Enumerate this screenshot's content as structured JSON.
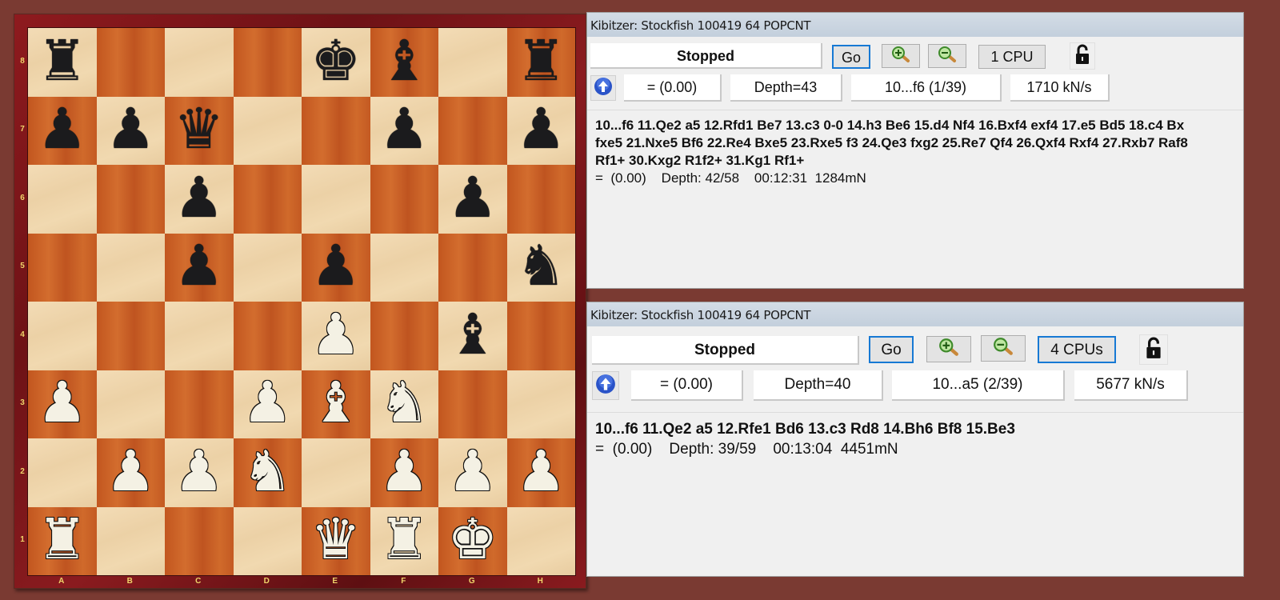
{
  "board": {
    "files": [
      "A",
      "B",
      "C",
      "D",
      "E",
      "F",
      "G",
      "H"
    ],
    "ranks": [
      "8",
      "7",
      "6",
      "5",
      "4",
      "3",
      "2",
      "1"
    ],
    "position": [
      [
        "bR",
        "",
        "",
        "",
        "bK",
        "bB",
        "",
        "bR"
      ],
      [
        "bP",
        "bP",
        "bQ",
        "",
        "",
        "bP",
        "",
        "bP"
      ],
      [
        "",
        "",
        "bP",
        "",
        "",
        "",
        "bP",
        ""
      ],
      [
        "",
        "",
        "bP",
        "",
        "bP",
        "",
        "",
        "bN"
      ],
      [
        "",
        "",
        "",
        "",
        "wP",
        "",
        "bB",
        ""
      ],
      [
        "wP",
        "",
        "",
        "wP",
        "wB",
        "wN",
        "",
        ""
      ],
      [
        "",
        "wP",
        "wP",
        "wN",
        "",
        "wP",
        "wP",
        "wP"
      ],
      [
        "wR",
        "",
        "",
        "",
        "wQ",
        "wR",
        "wK",
        ""
      ]
    ],
    "piece_names": {
      "K": "king",
      "Q": "queen",
      "R": "rook",
      "B": "bishop",
      "N": "knight",
      "P": "pawn"
    },
    "glyphs": {
      "K": "♚",
      "Q": "♛",
      "R": "♜",
      "B": "♝",
      "N": "♞",
      "P": "♟"
    }
  },
  "kibitzers": [
    {
      "title": "Kibitzer: Stockfish 100419 64 POPCNT",
      "status": "Stopped",
      "go_label": "Go",
      "cpu_label": "1 CPU",
      "eval": "=  (0.00)",
      "depth": "Depth=43",
      "current_move": "10...f6 (1/39)",
      "speed": "1710 kN/s",
      "pv_lines": [
        "10...f6 11.Qe2 a5 12.Rfd1 Be7 13.c3 0-0 14.h3 Be6 15.d4 Nf4 16.Bxf4 exf4 17.e5 Bd5 18.c4 Bx",
        "fxe5 21.Nxe5 Bf6 22.Re4 Bxe5 23.Rxe5 f3 24.Qe3 fxg2 25.Re7 Qf4 26.Qxf4 Rxf4 27.Rxb7 Raf8",
        "Rf1+ 30.Kxg2 R1f2+ 31.Kg1 Rf1+"
      ],
      "info": "=  (0.00)    Depth: 42/58    00:12:31  1284mN"
    },
    {
      "title": "Kibitzer: Stockfish 100419 64 POPCNT",
      "status": "Stopped",
      "go_label": "Go",
      "cpu_label": "4 CPUs",
      "eval": "=  (0.00)",
      "depth": "Depth=40",
      "current_move": "10...a5 (2/39)",
      "speed": "5677 kN/s",
      "pv_lines": [
        "10...f6 11.Qe2 a5 12.Rfe1 Bd6 13.c3 Rd8 14.Bh6 Bf8 15.Be3"
      ],
      "info": "=  (0.00)    Depth: 39/59    00:13:04  4451mN"
    }
  ],
  "colors": {
    "background": "#7a3a32",
    "focus_border": "#1779d4",
    "label_yellow": "#f0d46a"
  }
}
